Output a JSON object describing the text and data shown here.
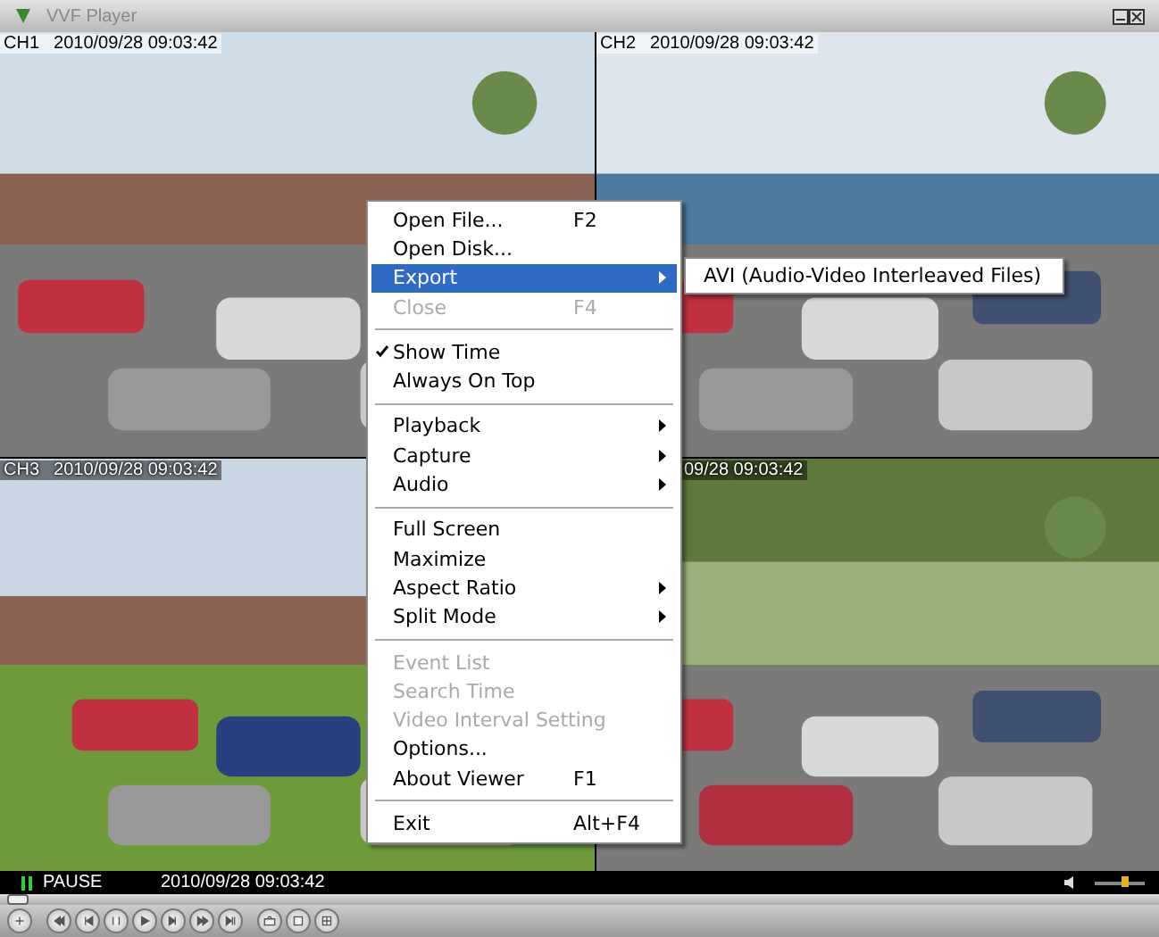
{
  "window": {
    "title": "VVF Player"
  },
  "channels": [
    {
      "label": "CH1",
      "time": "2010/09/28  09:03:42"
    },
    {
      "label": "CH2",
      "time": "2010/09/28  09:03:42"
    },
    {
      "label": "CH3",
      "time": "2010/09/28  09:03:42"
    },
    {
      "time": "09/28  09:03:42"
    }
  ],
  "menu": [
    {
      "kind": "item",
      "label": "Open File...",
      "shortcut": "F2",
      "disabled": false,
      "checked": false,
      "submenu": false,
      "selected": false
    },
    {
      "kind": "item",
      "label": "Open Disk...",
      "disabled": false,
      "checked": false,
      "submenu": false,
      "selected": false
    },
    {
      "kind": "item",
      "label": "Export",
      "disabled": false,
      "checked": false,
      "submenu": true,
      "selected": true
    },
    {
      "kind": "item",
      "label": "Close",
      "shortcut": "F4",
      "disabled": true,
      "checked": false,
      "submenu": false,
      "selected": false
    },
    {
      "kind": "separator"
    },
    {
      "kind": "item",
      "label": "Show Time",
      "disabled": false,
      "checked": true,
      "submenu": false,
      "selected": false
    },
    {
      "kind": "item",
      "label": "Always On Top",
      "disabled": false,
      "checked": false,
      "submenu": false,
      "selected": false
    },
    {
      "kind": "separator"
    },
    {
      "kind": "item",
      "label": "Playback",
      "disabled": false,
      "checked": false,
      "submenu": true,
      "selected": false
    },
    {
      "kind": "item",
      "label": "Capture",
      "disabled": false,
      "checked": false,
      "submenu": true,
      "selected": false
    },
    {
      "kind": "item",
      "label": "Audio",
      "disabled": false,
      "checked": false,
      "submenu": true,
      "selected": false
    },
    {
      "kind": "separator"
    },
    {
      "kind": "item",
      "label": "Full Screen",
      "disabled": false,
      "checked": false,
      "submenu": false,
      "selected": false
    },
    {
      "kind": "item",
      "label": "Maximize",
      "disabled": false,
      "checked": false,
      "submenu": false,
      "selected": false
    },
    {
      "kind": "item",
      "label": "Aspect Ratio",
      "disabled": false,
      "checked": false,
      "submenu": true,
      "selected": false
    },
    {
      "kind": "item",
      "label": "Split Mode",
      "disabled": false,
      "checked": false,
      "submenu": true,
      "selected": false
    },
    {
      "kind": "separator"
    },
    {
      "kind": "item",
      "label": "Event List",
      "disabled": true,
      "checked": false,
      "submenu": false,
      "selected": false
    },
    {
      "kind": "item",
      "label": "Search Time",
      "disabled": true,
      "checked": false,
      "submenu": false,
      "selected": false
    },
    {
      "kind": "item",
      "label": "Video Interval Setting",
      "disabled": true,
      "checked": false,
      "submenu": false,
      "selected": false
    },
    {
      "kind": "item",
      "label": "Options...",
      "disabled": false,
      "checked": false,
      "submenu": false,
      "selected": false
    },
    {
      "kind": "item",
      "label": "About Viewer",
      "shortcut": "F1",
      "disabled": false,
      "checked": false,
      "submenu": false,
      "selected": false
    },
    {
      "kind": "separator"
    },
    {
      "kind": "item",
      "label": "Exit",
      "shortcut": "Alt+F4",
      "disabled": false,
      "checked": false,
      "submenu": false,
      "selected": false
    }
  ],
  "submenu": [
    {
      "label": "AVI (Audio-Video Interleaved Files)"
    }
  ],
  "status_bar": {
    "state": "PAUSE",
    "time": "2010/09/28  09:03:42",
    "volume": {
      "level": 0.65
    }
  },
  "seek": {
    "level": 0
  }
}
